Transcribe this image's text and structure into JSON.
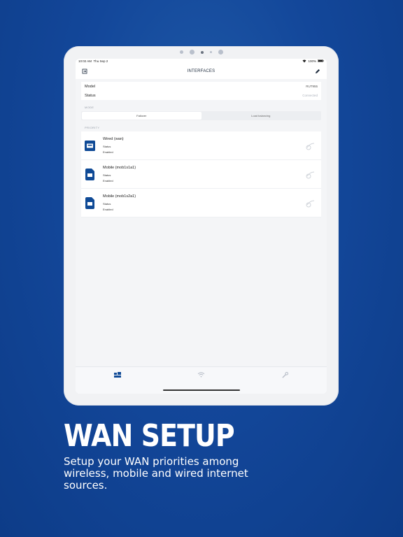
{
  "device": {
    "status_time": "10:02 AM",
    "status_date": "Thu Sep 2",
    "battery": "100%"
  },
  "nav": {
    "title": "INTERFACES"
  },
  "info": {
    "model_label": "Model",
    "model_value": "RUT955",
    "status_label": "Status",
    "status_value": "Connected"
  },
  "mode": {
    "label": "MODE",
    "options": [
      "Failover",
      "Load balancing"
    ],
    "selected": "Failover"
  },
  "priority": {
    "label": "PRIORITY",
    "interfaces": [
      {
        "name": "Wired (wan)",
        "status_label": "Status",
        "status_value": "Enabled",
        "icon": "ethernet-icon"
      },
      {
        "name": "Mobile (mob1s1a1)",
        "status_label": "Status",
        "status_value": "Enabled",
        "icon": "sim-card-icon"
      },
      {
        "name": "Mobile (mob1s2a1)",
        "status_label": "Status",
        "status_value": "Enabled",
        "icon": "sim-card-icon"
      }
    ]
  },
  "tabs": [
    "interfaces-icon",
    "wifi-icon",
    "tools-icon"
  ],
  "hero": {
    "title": "WAN SETUP",
    "subtitle": "Setup your WAN priorities among wireless, mobile and wired internet sources."
  },
  "colors": {
    "accent": "#0f4a96",
    "background": "#13479a"
  }
}
